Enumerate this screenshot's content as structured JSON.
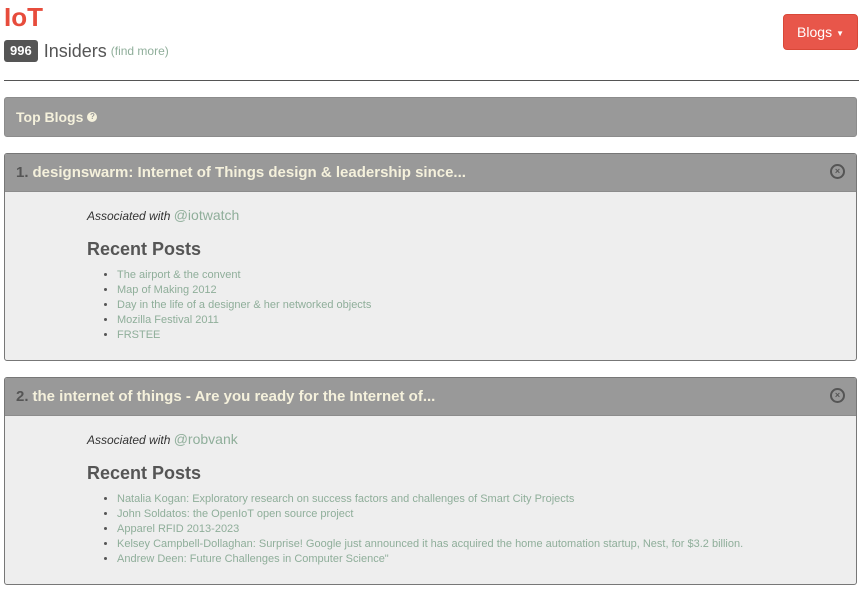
{
  "header": {
    "title": "IoT",
    "insiders_count": "996",
    "insiders_label": "Insiders",
    "find_more": "(find more)",
    "blogs_button": "Blogs"
  },
  "top_blogs": {
    "label": "Top Blogs",
    "help_icon": "question-circle-icon"
  },
  "blogs": [
    {
      "number": "1.",
      "title": "designswarm: Internet of Things design & leadership since...",
      "associated_label": "Associated with",
      "handle": "@iotwatch",
      "recent_posts_title": "Recent Posts",
      "posts": [
        "The airport & the convent",
        "Map of Making 2012",
        "Day in the life of a designer & her networked objects",
        "Mozilla Festival 2011",
        "FRSTEE"
      ]
    },
    {
      "number": "2.",
      "title": "the internet of things - Are you ready for the Internet of...",
      "associated_label": "Associated with",
      "handle": "@robvank",
      "recent_posts_title": "Recent Posts",
      "posts": [
        "Natalia Kogan: Exploratory research on success factors and challenges of Smart City Projects",
        "John Soldatos: the OpenIoT open source project",
        "Apparel RFID 2013-2023",
        "Kelsey Campbell-Dollaghan: Surprise! Google just announced it has acquired the home automation startup, Nest, for $3.2 billion.",
        "Andrew Deen: Future Challenges in Computer Science\""
      ]
    }
  ],
  "colors": {
    "brand": "#e74c3c",
    "panel": "#999999",
    "title_text": "#f5f1dc",
    "link": "#8fae9a"
  }
}
